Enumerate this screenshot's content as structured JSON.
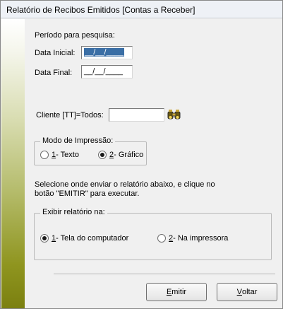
{
  "window": {
    "title": "Relatório de Recibos Emitidos [Contas a Receber]"
  },
  "period": {
    "heading": "Período para pesquisa:",
    "start_label": "Data Inicial:",
    "start_value": "__/__/____",
    "end_label": "Data Final:",
    "end_value": "__/__/____"
  },
  "client": {
    "label": "Cliente [TT]=Todos:",
    "value": "",
    "search_icon": "binoculars-search-icon"
  },
  "print_mode": {
    "legend": "Modo de Impressão:",
    "options": [
      {
        "key": "1",
        "label": " - Texto",
        "selected": false
      },
      {
        "key": "2",
        "label": " - Gráfico",
        "selected": true
      }
    ]
  },
  "instructions": {
    "line1": "Selecione onde enviar o relatório abaixo, e clique no",
    "line2": "botão \"EMITIR\" para executar."
  },
  "output": {
    "legend": "Exibir relatório na:",
    "options": [
      {
        "key": "1",
        "label": " - Tela do computador",
        "selected": true
      },
      {
        "key": "2",
        "label": " - Na impressora",
        "selected": false
      }
    ]
  },
  "buttons": {
    "emit_key": "E",
    "emit_rest": "mitir",
    "back_key": "V",
    "back_rest": "oltar"
  }
}
